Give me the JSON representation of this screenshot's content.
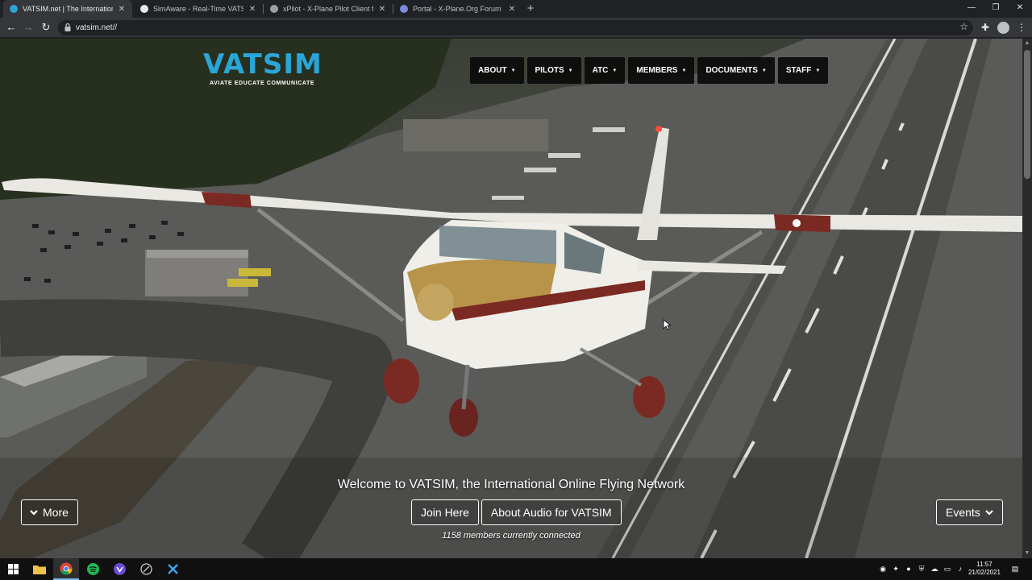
{
  "browser": {
    "tabs": [
      {
        "title": "VATSIM.net | The International O",
        "close": "✕",
        "favicon_color": "#2aa6d6"
      },
      {
        "title": "SimAware - Real-Time VATSIM Fli",
        "close": "✕",
        "favicon_color": "#e8eaed"
      },
      {
        "title": "xPilot - X-Plane Pilot Client for V",
        "close": "✕",
        "favicon_color": "#9aa0a6"
      },
      {
        "title": "Portal - X-Plane.Org Forum",
        "close": "✕",
        "favicon_color": "#7b8cde"
      }
    ],
    "new_tab": "+",
    "window_controls": {
      "minimize": "—",
      "maximize": "❐",
      "close": "✕"
    },
    "toolbar": {
      "back": "←",
      "forward": "→",
      "reload": "↻",
      "url": "vatsim.net//",
      "star": "☆",
      "extensions": "✚",
      "menu": "⋮"
    }
  },
  "site": {
    "logo_text": "VATSIM",
    "logo_tagline": "AVIATE EDUCATE COMMUNICATE",
    "nav": [
      {
        "label": "ABOUT",
        "caret": "▼"
      },
      {
        "label": "PILOTS",
        "caret": "▼"
      },
      {
        "label": "ATC",
        "caret": "▼"
      },
      {
        "label": "MEMBERS",
        "caret": "▼"
      },
      {
        "label": "DOCUMENTS",
        "caret": "▼"
      },
      {
        "label": "STAFF",
        "caret": "▼"
      }
    ],
    "hero_title": "Welcome to VATSIM, the International Online Flying Network",
    "join_label": "Join Here",
    "audio_label": "About Audio for VATSIM",
    "members_text": "1158 members currently connected",
    "more_label": "More",
    "events_label": "Events",
    "colors": {
      "brand": "#2aa6d6",
      "nav_bg": "#0a0a0a"
    }
  },
  "taskbar": {
    "apps": [
      "windows-start",
      "file-explorer",
      "chrome",
      "spotify",
      "vpn",
      "clock-app",
      "xcode-like"
    ],
    "time": "11:57",
    "date": "21/02/2021"
  }
}
